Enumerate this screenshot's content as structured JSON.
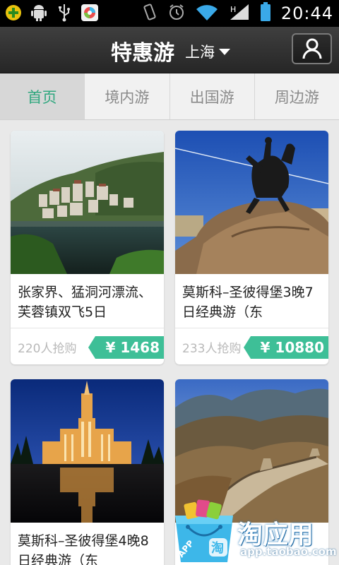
{
  "status_bar": {
    "time": "20:44",
    "icons": [
      "add-icon",
      "android-icon",
      "usb-icon",
      "app-icon",
      "vibrate-icon",
      "alarm-icon",
      "wifi-icon",
      "signal-icon",
      "battery-icon"
    ]
  },
  "header": {
    "title": "特惠游",
    "city": "上海",
    "user_icon": "user-icon"
  },
  "tabs": [
    {
      "label": "首页",
      "active": true
    },
    {
      "label": "境内游",
      "active": false
    },
    {
      "label": "出国游",
      "active": false
    },
    {
      "label": "周边游",
      "active": false
    }
  ],
  "cards": [
    {
      "title": "张家界、猛洞河漂流、芙蓉镇双飞5日",
      "sold": "220人抢购",
      "price": "¥ 1468"
    },
    {
      "title": "莫斯科–圣彼得堡3晚7日经典游（东",
      "sold": "233人抢购",
      "price": "¥ 10880"
    },
    {
      "title": "莫斯科–圣彼得堡4晚8日经典游（东",
      "sold": "",
      "price": ""
    },
    {
      "title": "",
      "sold": "",
      "price": ""
    }
  ],
  "watermark": {
    "name": "淘应用",
    "url": "app.taobao.com",
    "badge": "APP",
    "bag_char": "淘"
  },
  "colors": {
    "accent": "#3ebf97",
    "tab_active_text": "#2fa77e",
    "header_bg": "#2e2e2e"
  }
}
